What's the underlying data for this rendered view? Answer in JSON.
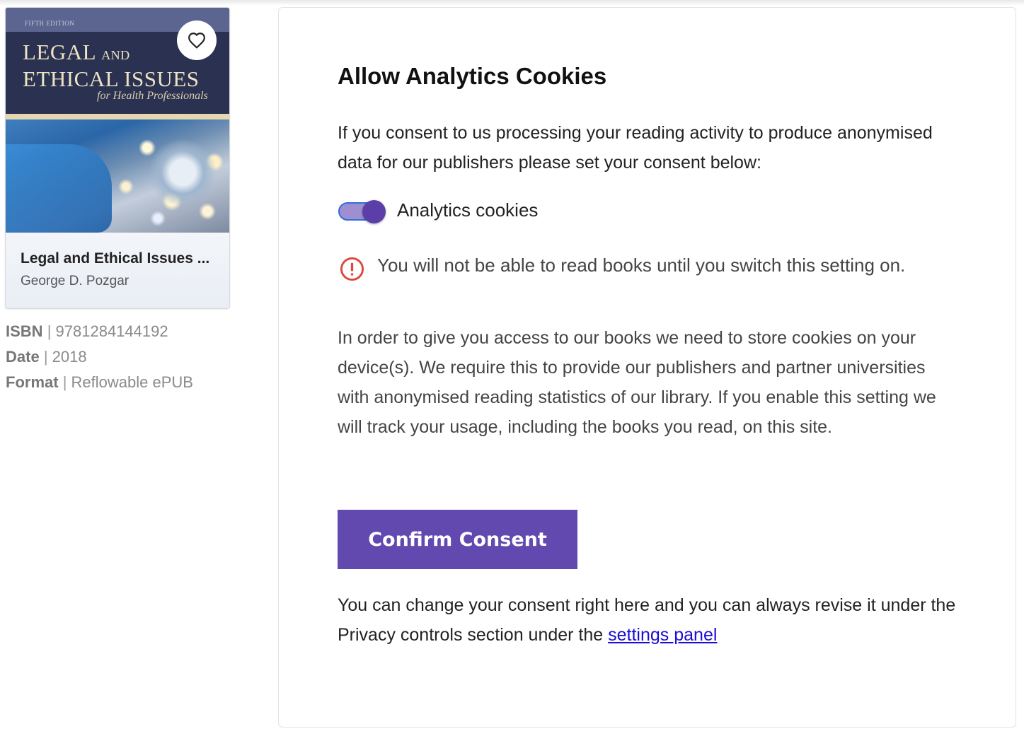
{
  "book": {
    "cover": {
      "edition": "FIFTH EDITION",
      "title_line1": "LEGAL",
      "title_and": "AND",
      "title_line2": "ETHICAL ISSUES",
      "subtitle": "for Health Professionals"
    },
    "title": "Legal and Ethical Issues ...",
    "author": "George D. Pozgar",
    "meta": {
      "isbn_label": "ISBN",
      "isbn": "9781284144192",
      "date_label": "Date",
      "date": "2018",
      "format_label": "Format",
      "format": "Reflowable ePUB",
      "separator": "|"
    }
  },
  "consent": {
    "title": "Allow Analytics Cookies",
    "intro": "If you consent to us processing your reading activity to produce anonymised data for our publishers please set your consent below:",
    "toggle_label": "Analytics cookies",
    "toggle_on": true,
    "warning": "You will not be able to read books until you switch this setting on.",
    "body": "In order to give you access to our books we need to store cookies on your device(s). We require this to provide our publishers and partner universities with anonymised reading statistics of our library. If you enable this setting we will track your usage, including the books you read, on this site.",
    "button_label": "Confirm Consent",
    "footer_text": "You can change your consent right here and you can always revise it under the Privacy controls section under the ",
    "footer_link": "settings panel"
  },
  "colors": {
    "button": "#6249b0",
    "toggle_knob": "#5b3ea8",
    "warning": "#e0453a",
    "link": "#1a0dd4"
  },
  "icons": {
    "favorite": "heart-icon",
    "warning": "alert-circle-icon"
  }
}
